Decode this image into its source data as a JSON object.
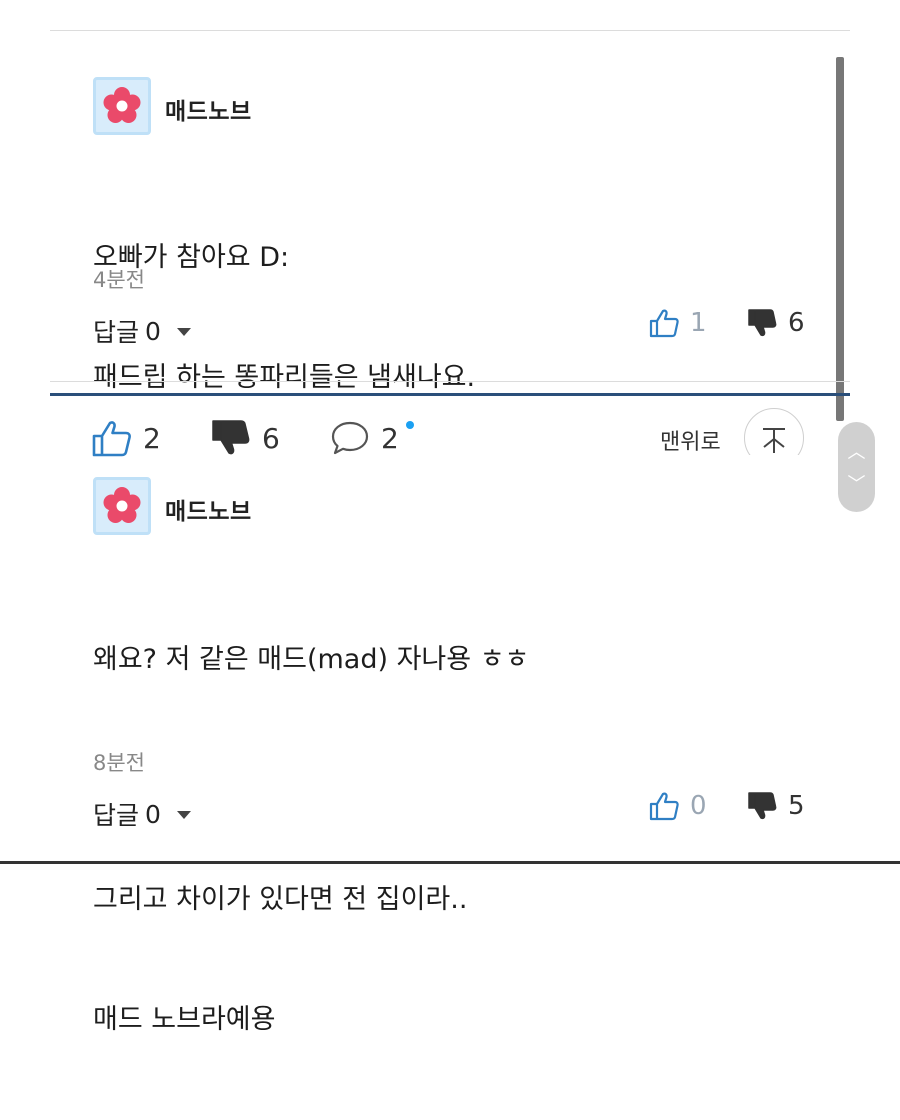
{
  "comments": [
    {
      "nickname": "매드노브",
      "lines": [
        "오빠가 참아요 D:",
        "패드립 하는 똥파리들은 냄새나요."
      ],
      "time": "4분전",
      "reply_label": "답글",
      "reply_count": "0",
      "likes": "1",
      "dislikes": "6"
    },
    {
      "nickname": "매드노브",
      "lines": [
        "왜요? 저 같은 매드(mad) 자나용 ㅎㅎ",
        "",
        "그리고 차이가 있다면 전 집이라..",
        "매드 노브라예용"
      ],
      "time": "8분전",
      "reply_label": "답글",
      "reply_count": "0",
      "likes": "0",
      "dislikes": "5"
    }
  ],
  "toolbar": {
    "likes": "2",
    "dislikes": "6",
    "comments": "2",
    "to_top_label": "맨위로",
    "to_top_icon": "arrow-up-icon"
  },
  "pager": {
    "up_icon": "chevron-up-icon",
    "down_icon": "chevron-down-icon"
  },
  "colors": {
    "accent_bar": "#2a4f7a",
    "new_dot": "#1ba0f2",
    "avatar_bg": "#d8ecfb",
    "flower": "#ea4a6a"
  }
}
